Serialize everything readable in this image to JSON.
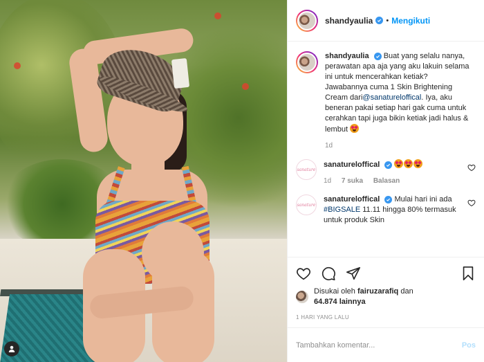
{
  "post": {
    "author": "shandyaulia",
    "follow_label": "Mengikuti",
    "dot": "•"
  },
  "caption": {
    "author": "shandyaulia",
    "text_1": "Buat yang selalu nanya, perawatan apa aja yang aku lakuin selama ini untuk mencerahkan ketiak?",
    "text_2": "Jawabannya cuma 1 Skin Brightening Cream dari",
    "mention": "@sanatureloffical",
    "text_3": ". Iya, aku beneran pakai setiap hari gak cuma untuk cerahkan tapi juga bikin ketiak jadi halus & lembut",
    "age": "1d"
  },
  "comments": [
    {
      "author": "sanatureloffical",
      "age": "1d",
      "likes": "7 suka",
      "reply": "Balasan"
    },
    {
      "author": "sanatureloffical",
      "text_1": "Mulai hari ini ada ",
      "hashtag": "#BIGSALE",
      "text_2": " 11.11 hingga 80% termasuk untuk produk Skin"
    }
  ],
  "likes": {
    "prefix": "Disukai oleh ",
    "user": "fairuzarafiq",
    "mid": " dan",
    "count": "64.874 lainnya"
  },
  "timestamp": "1 HARI YANG LALU",
  "add_comment": {
    "placeholder": "Tambahkan komentar...",
    "post_label": "Pos"
  },
  "avatar_brand_text": "sanature",
  "colors": {
    "accent": "#0095f6",
    "verified": "#3897f0",
    "muted": "#8e8e8e"
  }
}
